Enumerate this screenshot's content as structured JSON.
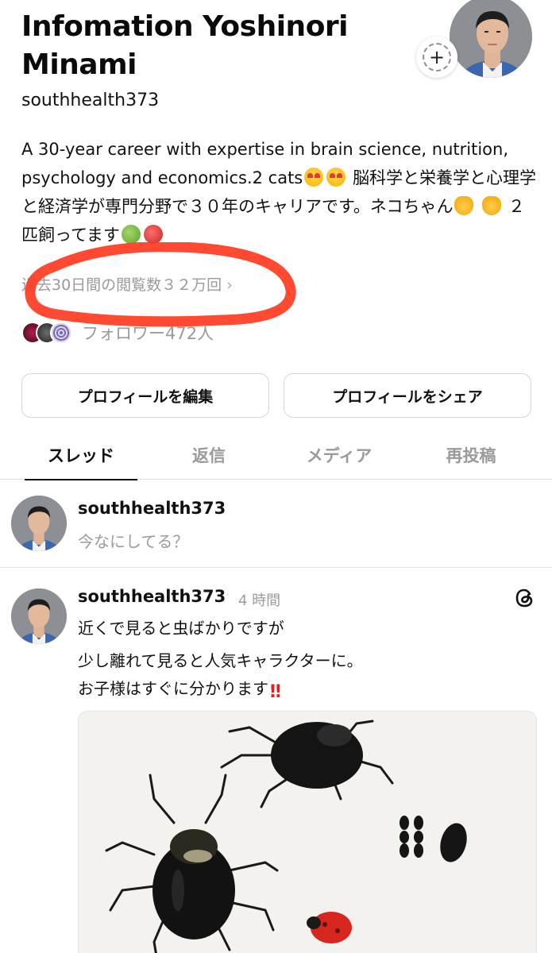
{
  "profile": {
    "display_name": "Infomation Yoshinori Minami",
    "username": "southhealth373",
    "bio_part1": "A 30-year career with expertise in brain science, nutrition, psychology and economics.2 cats",
    "bio_part2": " 脳科学と栄養学と心理学と経済学が専門分野で３０年のキャリアです。ネコちゃん",
    "bio_part3": " ２匹飼ってます",
    "views": "過去30日間の閲覧数３２万回",
    "followers": "フォロワー472人"
  },
  "buttons": {
    "edit_profile": "プロフィールを編集",
    "share_profile": "プロフィールをシェア"
  },
  "tabs": [
    {
      "label": "スレッド",
      "active": true
    },
    {
      "label": "返信",
      "active": false
    },
    {
      "label": "メディア",
      "active": false
    },
    {
      "label": "再投稿",
      "active": false
    }
  ],
  "composer": {
    "username": "southhealth373",
    "placeholder": "今なにしてる？"
  },
  "post": {
    "username": "southhealth373",
    "time": "4 時間",
    "line1": "近くで見ると虫ばかりですが",
    "line2": "少し離れて見ると人気キャラクターに。",
    "line3": "お子様はすぐに分かります"
  },
  "icons": {
    "chevron": "chevron-right-icon",
    "add": "plus-icon",
    "threads": "threads-logo-icon"
  },
  "colors": {
    "annotation": "#ff3b1f",
    "muted_text": "#9a9a9a",
    "text": "#111111"
  }
}
